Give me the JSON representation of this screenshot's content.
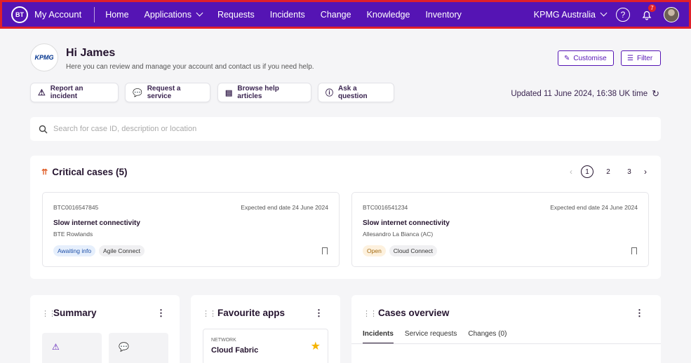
{
  "nav": {
    "logo": "BT",
    "brand": "My Account",
    "items": [
      "Home",
      "Applications",
      "Requests",
      "Incidents",
      "Change",
      "Knowledge",
      "Inventory"
    ],
    "org": "KPMG Australia",
    "help": "?",
    "notif_count": "7"
  },
  "header": {
    "company_logo": "KPMG",
    "greeting": "Hi James",
    "subtitle": "Here you can review and manage your account and contact us if you need help.",
    "customise_label": "Customise",
    "filter_label": "Filter"
  },
  "actions": [
    {
      "label": "Report an incident",
      "icon": "warning-icon"
    },
    {
      "label": "Request a service",
      "icon": "chat-icon"
    },
    {
      "label": "Browse help articles",
      "icon": "document-icon"
    },
    {
      "label": "Ask a question",
      "icon": "question-icon"
    }
  ],
  "updated": "Updated 11 June 2024, 16:38 UK time",
  "search": {
    "placeholder": "Search for case ID, description or location"
  },
  "critical": {
    "title": "Critical cases (5)",
    "pages": [
      "1",
      "2",
      "3"
    ],
    "current_page": 1,
    "cases": [
      {
        "id": "BTC0016547845",
        "date": "Expected end date 24 June 2024",
        "title": "Slow internet connectivity",
        "sub": "BTE Rowlands",
        "status": "Awaiting info",
        "product": "Agile Connect"
      },
      {
        "id": "BTC0016541234",
        "date": "Expected end date 24 June 2024",
        "title": "Slow internet connectivity",
        "sub": "Allesandro La Bianca (AC)",
        "status": "Open",
        "product": "Cloud Connect"
      }
    ]
  },
  "summary": {
    "title": "Summary"
  },
  "favourites": {
    "title": "Favourite apps",
    "app_category": "NETWORK",
    "app_name": "Cloud Fabric"
  },
  "cases_overview": {
    "title": "Cases overview",
    "tabs": [
      "Incidents",
      "Service requests",
      "Changes (0)"
    ]
  },
  "colors": {
    "brand": "#5514b4",
    "highlight_border": "#e0202a",
    "star": "#f5b400"
  }
}
